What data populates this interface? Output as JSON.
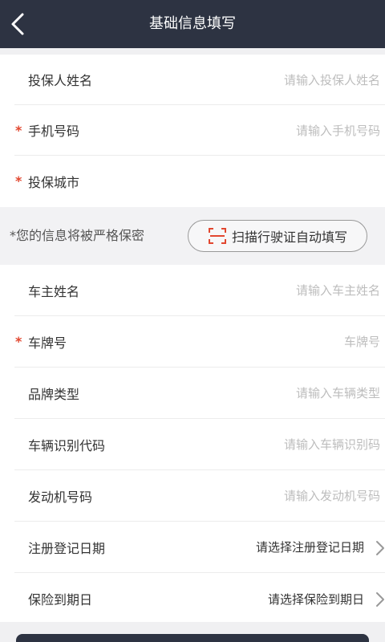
{
  "header": {
    "title": "基础信息填写",
    "back_icon": "back-arrow-icon"
  },
  "section1": {
    "rows": [
      {
        "label": "投保人姓名",
        "required": "",
        "placeholder": "请输入投保人姓名"
      },
      {
        "label": "手机号码",
        "required": "*",
        "placeholder": "请输入手机号码"
      },
      {
        "label": "投保城市",
        "required": "*",
        "placeholder": ""
      }
    ]
  },
  "notice": {
    "text": "*您的信息将被严格保密",
    "scan_button": "扫描行驶证自动填写",
    "scan_icon": "scan-icon",
    "accent_color": "#e2472f"
  },
  "section2": {
    "rows": [
      {
        "label": "车主姓名",
        "required": "",
        "placeholder": "请输入车主姓名"
      },
      {
        "label": "车牌号",
        "required": "*",
        "placeholder": "车牌号"
      },
      {
        "label": "品牌类型",
        "required": "",
        "placeholder": "请输入车辆类型"
      },
      {
        "label": "车辆识别代码",
        "required": "",
        "placeholder": "请输入车辆识别码"
      },
      {
        "label": "发动机号码",
        "required": "",
        "placeholder": "请输入发动机号码"
      },
      {
        "label": "注册登记日期",
        "required": "",
        "value": "请选择注册登记日期",
        "icon": "chevron-right-icon"
      },
      {
        "label": "保险到期日",
        "required": "",
        "value": "请选择保险到期日",
        "icon": "chevron-right-icon"
      }
    ]
  },
  "colors": {
    "header_bg": "#2d3342",
    "required": "#e2472f",
    "placeholder": "#bdbdbd"
  }
}
